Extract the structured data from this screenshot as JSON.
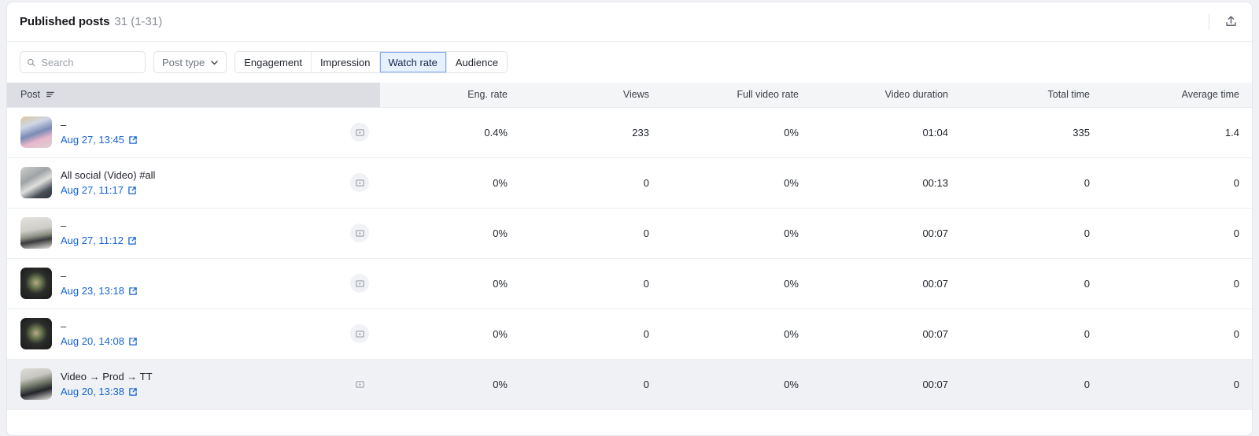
{
  "header": {
    "title": "Published posts",
    "count": "31 (1-31)",
    "export_icon": "export-upload-icon"
  },
  "toolbar": {
    "search_placeholder": "Search",
    "search_value": "",
    "search_icon": "search-icon",
    "post_type_label": "Post type",
    "chevron_icon": "chevron-down-icon",
    "segments": [
      {
        "label": "Engagement",
        "active": false
      },
      {
        "label": "Impression",
        "active": false
      },
      {
        "label": "Watch rate",
        "active": true
      },
      {
        "label": "Audience",
        "active": false
      }
    ]
  },
  "table": {
    "columns": [
      {
        "key": "post",
        "label": "Post",
        "align": "left",
        "sort_icon": "sort-descending-icon"
      },
      {
        "key": "eng_rate",
        "label": "Eng. rate",
        "align": "right"
      },
      {
        "key": "views",
        "label": "Views",
        "align": "right"
      },
      {
        "key": "full_video_rate",
        "label": "Full video rate",
        "align": "right"
      },
      {
        "key": "video_duration",
        "label": "Video duration",
        "align": "right"
      },
      {
        "key": "total_time",
        "label": "Total time",
        "align": "right"
      },
      {
        "key": "average_time",
        "label": "Average time",
        "align": "right"
      }
    ],
    "rows": [
      {
        "title": "–",
        "date": "Aug 27, 13:45",
        "thumb": "floral-blue-pink",
        "media_icon": "video-play-icon",
        "eng_rate": "0.4%",
        "views": "233",
        "full_video_rate": "0%",
        "video_duration": "01:04",
        "total_time": "335",
        "average_time": "1.4",
        "hovered": false
      },
      {
        "title": "All social (Video) #all",
        "date": "Aug 27, 11:17",
        "thumb": "vr-headset-person",
        "media_icon": "video-play-icon",
        "eng_rate": "0%",
        "views": "0",
        "full_video_rate": "0%",
        "video_duration": "00:13",
        "total_time": "0",
        "average_time": "0",
        "hovered": false
      },
      {
        "title": "–",
        "date": "Aug 27, 11:12",
        "thumb": "person-bouquet-light",
        "media_icon": "video-play-icon",
        "eng_rate": "0%",
        "views": "0",
        "full_video_rate": "0%",
        "video_duration": "00:07",
        "total_time": "0",
        "average_time": "0",
        "hovered": false
      },
      {
        "title": "–",
        "date": "Aug 23, 13:18",
        "thumb": "dark-food-bowl",
        "media_icon": "video-play-icon",
        "eng_rate": "0%",
        "views": "0",
        "full_video_rate": "0%",
        "video_duration": "00:07",
        "total_time": "0",
        "average_time": "0",
        "hovered": false
      },
      {
        "title": "–",
        "date": "Aug 20, 14:08",
        "thumb": "dark-food-bowl",
        "media_icon": "video-play-icon",
        "eng_rate": "0%",
        "views": "0",
        "full_video_rate": "0%",
        "video_duration": "00:07",
        "total_time": "0",
        "average_time": "0",
        "hovered": false
      },
      {
        "title": "Video → Prod → TT",
        "date": "Aug 20, 13:38",
        "thumb": "wedding-couple",
        "media_icon": "video-play-icon",
        "eng_rate": "0%",
        "views": "0",
        "full_video_rate": "0%",
        "video_duration": "00:07",
        "total_time": "0",
        "average_time": "0",
        "hovered": true
      }
    ]
  },
  "colors": {
    "link": "#1564d4",
    "active_segment_bg": "#e7f0fd",
    "active_segment_border": "#7fa9ee",
    "post_header_bg": "#dcdee4",
    "header_bg": "#f4f5f7"
  }
}
